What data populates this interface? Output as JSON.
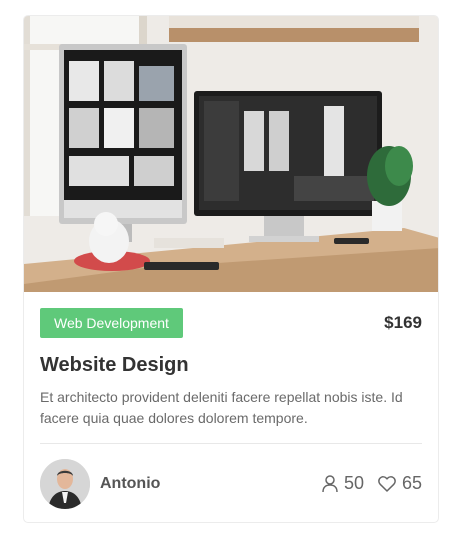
{
  "card": {
    "image_alt": "Workspace with two monitors",
    "category": "Web Development",
    "price": "$169",
    "title": "Website Design",
    "description": "Et architecto provident deleniti facere repellat nobis iste. Id facere quia quae dolores dolorem tempore.",
    "author": {
      "name": "Antonio"
    },
    "stats": {
      "students": "50",
      "likes": "65"
    }
  },
  "icons": {
    "students": "user-icon",
    "likes": "heart-icon"
  },
  "colors": {
    "category_bg": "#5fc97a",
    "category_text": "#ffffff",
    "title": "#333333",
    "description": "#6a6a6a"
  }
}
